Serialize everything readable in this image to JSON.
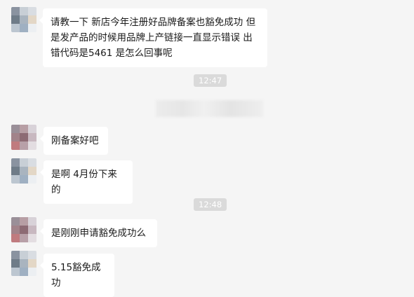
{
  "messages": [
    {
      "text": "请教一下 新店今年注册好品牌备案也豁免成功 但是发产品的时候用品牌上产链接一直显示错误  出错代码是5461 是怎么回事呢"
    },
    {
      "text": "刚备案好吧"
    },
    {
      "text": "是啊 4月份下来的"
    },
    {
      "text": "是刚刚申请豁免成功么"
    },
    {
      "text": "5.15豁免成功"
    }
  ],
  "timestamps": [
    "12:47",
    "12:48"
  ]
}
